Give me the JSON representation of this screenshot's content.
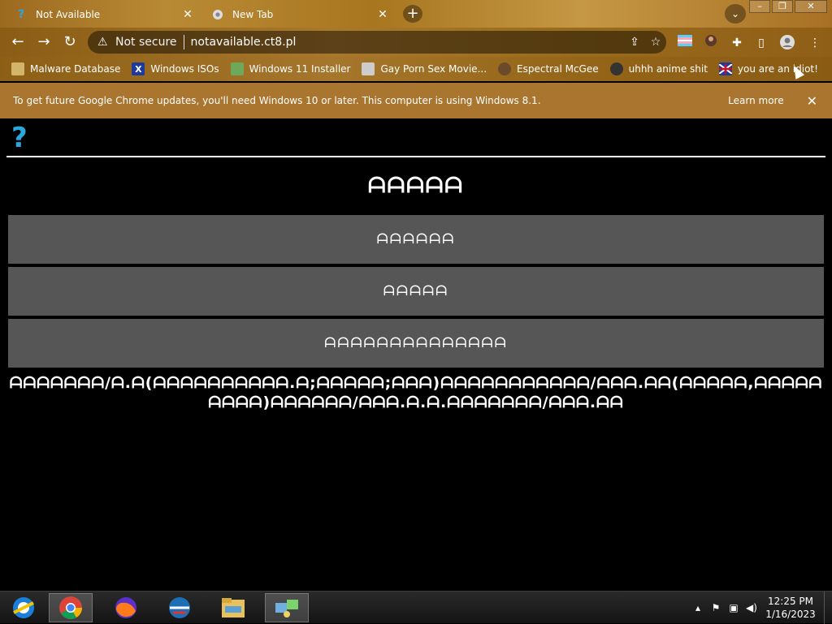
{
  "browser": {
    "tabs": [
      {
        "title": "Not Available",
        "favicon": "question-icon",
        "active": true
      },
      {
        "title": "New Tab",
        "favicon": "chrome-icon",
        "active": false
      }
    ],
    "address": {
      "security_label": "Not secure",
      "url": "notavailable.ct8.pl"
    },
    "bookmarks": [
      {
        "label": "Malware Database",
        "icon": "bookmark-icon"
      },
      {
        "label": "Windows ISOs",
        "icon": "x-icon"
      },
      {
        "label": "Windows 11 Installer",
        "icon": "image-icon"
      },
      {
        "label": "Gay Porn Sex Movie...",
        "icon": "bookmark-icon"
      },
      {
        "label": "Espectral McGee",
        "icon": "avatar-icon"
      },
      {
        "label": "uhhh anime shit",
        "icon": "avatar-icon"
      },
      {
        "label": "you are an idiot!",
        "icon": "flag-icon"
      }
    ],
    "infobar": {
      "message": "To get future Google Chrome updates, you'll need Windows 10 or later. This computer is using Windows 8.1.",
      "action": "Learn more"
    }
  },
  "page": {
    "heading": "ᗩᗩᗩᗩᗩ",
    "buttons": [
      {
        "label": "ᗩᗩᗩᗩᗩᗩ"
      },
      {
        "label": "ᗩᗩᗩᗩᗩ"
      },
      {
        "label": "ᗩᗩᗩᗩᗩᗩᗩᗩᗩᗩᗩᗩᗩᗩ"
      }
    ],
    "paragraph": "ᗩᗩᗩᗩᗩᗩᗩ/ᗩ.ᗩ(ᗩᗩᗩᗩᗩᗩᗩᗩᗩᗩ.ᗩ;ᗩᗩᗩᗩᗩ;ᗩᗩᗩ)ᗩᗩᗩᗩᗩᗩᗩᗩᗩᗩᗩ/ᗩᗩᗩ.ᗩᗩ(ᗩᗩᗩᗩᗩ,ᗩᗩᗩᗩᗩᗩᗩᗩᗩ)ᗩᗩᗩᗩᗩᗩ/ᗩᗩᗩ.ᗩ.ᗩ.ᗩᗩᗩᗩᗩᗩᗩ/ᗩᗩᗩ.ᗩᗩ"
  },
  "taskbar": {
    "apps": [
      "ie-icon",
      "chrome-icon",
      "firefox-icon",
      "opera-icon",
      "file-explorer-icon",
      "network-icon"
    ],
    "time": "12:25 PM",
    "date": "1/16/2023"
  },
  "colors": {
    "accent": "#aa762f",
    "page_bg": "#000000",
    "button_bg": "#565656",
    "logo": "#29a8e0"
  }
}
